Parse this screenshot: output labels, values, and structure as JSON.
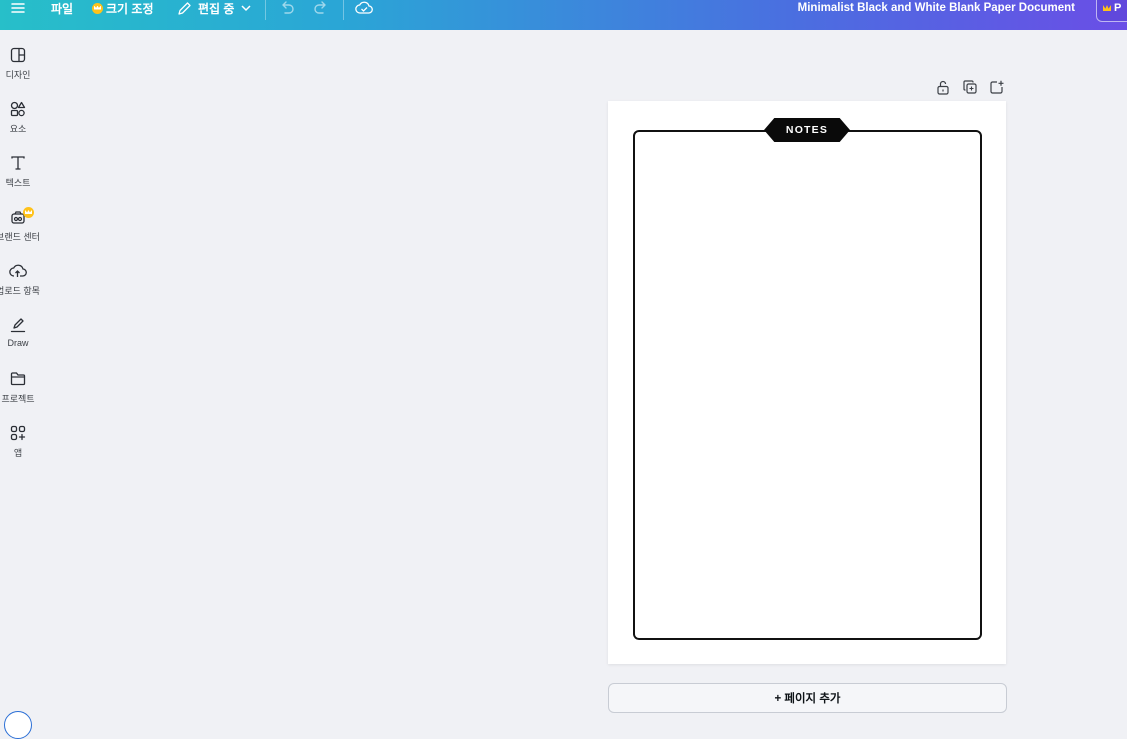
{
  "topbar": {
    "file_label": "파일",
    "resize_label": "크기 조정",
    "editing_label": "편집 중",
    "document_title": "Minimalist Black and White Blank Paper Document",
    "pro_label": "P"
  },
  "sidebar": {
    "items": [
      {
        "label": "디자인",
        "icon": "layout-icon"
      },
      {
        "label": "요소",
        "icon": "shapes-icon"
      },
      {
        "label": "텍스트",
        "icon": "text-icon"
      },
      {
        "label": "브랜드 센터",
        "icon": "brand-icon"
      },
      {
        "label": "업로드 항목",
        "icon": "cloud-upload-icon"
      },
      {
        "label": "Draw",
        "icon": "pen-icon"
      },
      {
        "label": "프로젝트",
        "icon": "folder-icon"
      },
      {
        "label": "앱",
        "icon": "apps-icon"
      }
    ]
  },
  "canvas": {
    "notes_tag": "NOTES",
    "add_page_label": "+ 페이지 추가"
  },
  "colors": {
    "gradient_start": "#27bfc9",
    "gradient_end": "#6a4ee6",
    "crown": "#ffc21a",
    "canvas_bg": "#f0f1f5"
  }
}
